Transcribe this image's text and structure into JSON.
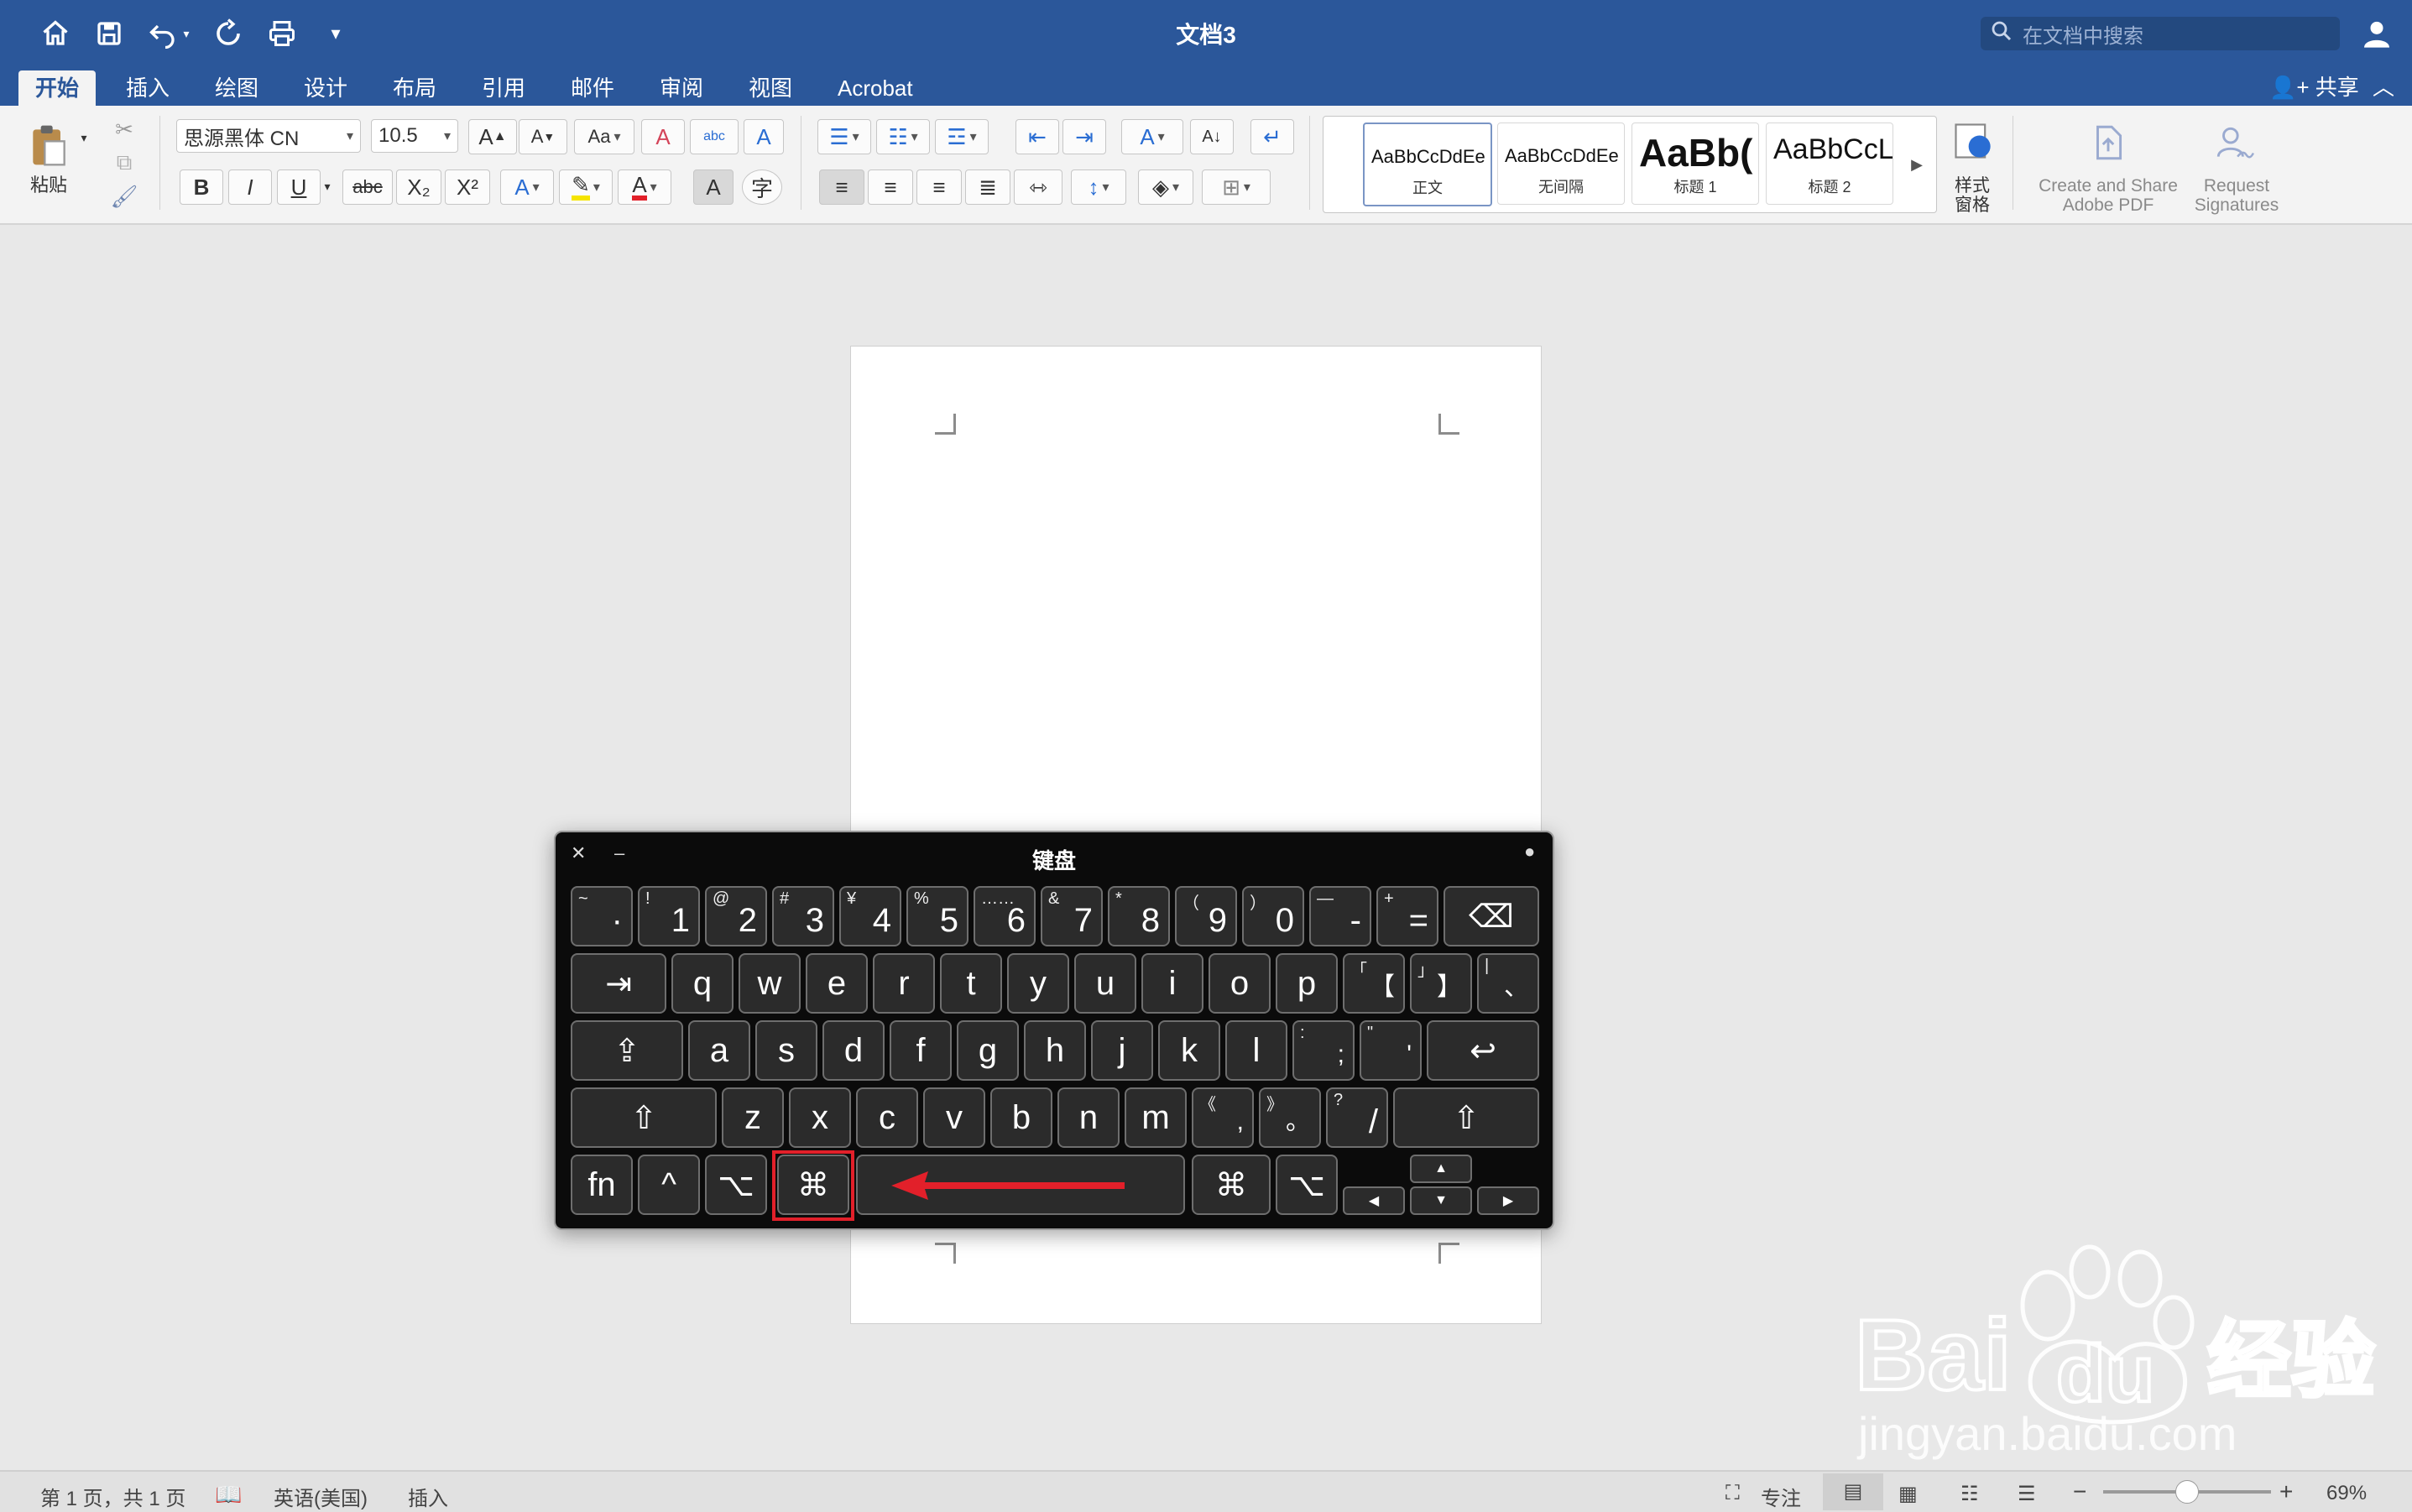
{
  "title_bar": {
    "title": "文档3",
    "search_placeholder": "在文档中搜索",
    "quick_access": [
      "home-icon",
      "save-icon",
      "undo-icon",
      "redo-icon",
      "print-icon",
      "customize-icon"
    ]
  },
  "tabs": [
    "开始",
    "插入",
    "绘图",
    "设计",
    "布局",
    "引用",
    "邮件",
    "审阅",
    "视图",
    "Acrobat"
  ],
  "active_tab": "开始",
  "share_label": "共享",
  "ribbon": {
    "paste_label": "粘贴",
    "font_name": "思源黑体 CN",
    "font_size": "10.5",
    "format_buttons": [
      "B",
      "I",
      "U",
      "abc",
      "X₂",
      "X²"
    ],
    "styles": [
      {
        "sample": "AaBbCcDdEe",
        "name": "正文"
      },
      {
        "sample": "AaBbCcDdEe",
        "name": "无间隔"
      },
      {
        "sample": "AaBb(",
        "name": "标题 1"
      },
      {
        "sample": "AaBbCcL",
        "name": "标题 2"
      }
    ],
    "styles_pane_label": "样式\n窗格",
    "style_pane_line1": "样式",
    "style_pane_line2": "窗格",
    "acrobat_create_line1": "Create and Share",
    "acrobat_create_line2": "Adobe PDF",
    "acrobat_request_line1": "Request",
    "acrobat_request_line2": "Signatures"
  },
  "keyboard": {
    "title": "键盘",
    "row1": [
      {
        "sh": "~",
        "m": "·"
      },
      {
        "sh": "!",
        "m": "1"
      },
      {
        "sh": "@",
        "m": "2"
      },
      {
        "sh": "#",
        "m": "3"
      },
      {
        "sh": "¥",
        "m": "4"
      },
      {
        "sh": "%",
        "m": "5"
      },
      {
        "sh": "……",
        "m": "6"
      },
      {
        "sh": "&",
        "m": "7"
      },
      {
        "sh": "*",
        "m": "8"
      },
      {
        "sh": "（",
        "m": "9"
      },
      {
        "sh": "）",
        "m": "0"
      },
      {
        "sh": "—",
        "m": "-"
      },
      {
        "sh": "+",
        "m": "="
      }
    ],
    "row2": [
      "q",
      "w",
      "e",
      "r",
      "t",
      "y",
      "u",
      "i",
      "o",
      "p"
    ],
    "row2_brackets": [
      {
        "sh": "「",
        "m": "【"
      },
      {
        "sh": "」",
        "m": "】"
      },
      {
        "sh": "|",
        "m": "、"
      }
    ],
    "row3": [
      "a",
      "s",
      "d",
      "f",
      "g",
      "h",
      "j",
      "k",
      "l"
    ],
    "row3_punct": [
      {
        "sh": ":",
        "m": ";"
      },
      {
        "sh": "\"",
        "m": "'"
      }
    ],
    "row4": [
      "z",
      "x",
      "c",
      "v",
      "b",
      "n",
      "m"
    ],
    "row4_punct": [
      {
        "sh": "《",
        "m": ","
      },
      {
        "sh": "》",
        "m": "。"
      },
      {
        "sh": "?",
        "m": "/"
      }
    ],
    "fn_label": "fn",
    "ctrl_symbol": "^",
    "option_symbol": "⌥",
    "command_symbol": "⌘",
    "tab_symbol": "⇥",
    "delete_symbol": "⌫",
    "capslock_symbol": "⇪",
    "return_symbol": "↩",
    "shift_symbol": "⇧",
    "annotation_color": "#e2202a"
  },
  "status_bar": {
    "page_info": "第 1 页，共 1 页",
    "language": "英语(美国)",
    "mode": "插入",
    "focus": "专注",
    "zoom": "69%",
    "zoom_fraction": 0.5
  },
  "watermark": {
    "text_baidu": "Bai",
    "text_du": "du",
    "text_jingyan": "经验",
    "url": "jingyan.baidu.com"
  },
  "colors": {
    "title_bar": "#2b579a",
    "ribbon_bg": "#f3f3f3",
    "keyboard_bg": "#0b0b0b",
    "highlight": "#e2202a"
  }
}
